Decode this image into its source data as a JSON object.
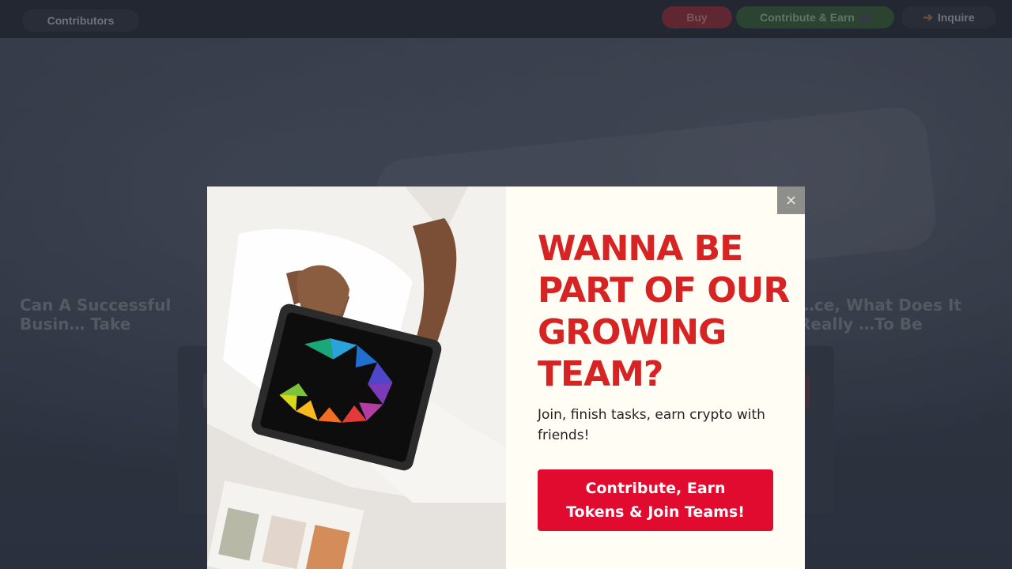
{
  "nav": {
    "contributors_label": "Contributors",
    "buy_label": "Buy",
    "contribute_label": "Contribute & Earn",
    "inquire_label": "Inquire"
  },
  "background_article": {
    "title_left": "Can A Successful Busin… Take",
    "title_right": "…ce, What Does It Really …To Be"
  },
  "popup": {
    "headline": "WANNA BE PART OF OUR GROWING TEAM?",
    "subtext": "Join, finish tasks, earn crypto with friends!",
    "cta_label": "Contribute, Earn Tokens & Join Teams!",
    "close_label": "×",
    "colors": {
      "headline": "#d62424",
      "cta_background": "#e00b2f",
      "panel_background": "#fffdf4",
      "close_background": "#8e8e8b"
    }
  },
  "icons": {
    "close": "close-icon",
    "inquire": "arrow-right-icon",
    "logo": "colorful-logo-icon"
  }
}
